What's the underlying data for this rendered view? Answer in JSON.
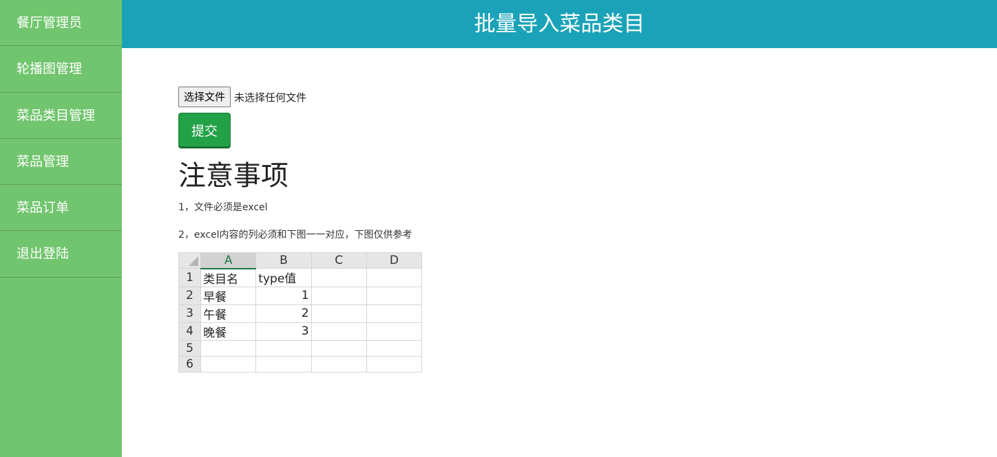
{
  "sidebar": {
    "items": [
      {
        "label": "餐厅管理员"
      },
      {
        "label": "轮播图管理"
      },
      {
        "label": "菜品类目管理"
      },
      {
        "label": "菜品管理"
      },
      {
        "label": "菜品订单"
      },
      {
        "label": "退出登陆"
      }
    ]
  },
  "header": {
    "title": "批量导入菜品类目"
  },
  "upload": {
    "choose_label": "选择文件",
    "status_text": "未选择任何文件",
    "submit_label": "提交"
  },
  "notes": {
    "heading": "注意事项",
    "line1": "1，文件必须是excel",
    "line2": "2，excel内容的列必须和下图一一对应，下图仅供参考"
  },
  "sheet": {
    "columns": [
      "A",
      "B",
      "C",
      "D"
    ],
    "rows": [
      {
        "num": "1",
        "a": "类目名",
        "b": "type值"
      },
      {
        "num": "2",
        "a": "早餐",
        "b": "1"
      },
      {
        "num": "3",
        "a": "午餐",
        "b": "2"
      },
      {
        "num": "4",
        "a": "晚餐",
        "b": "3"
      },
      {
        "num": "5",
        "a": "",
        "b": ""
      },
      {
        "num": "6",
        "a": "",
        "b": ""
      }
    ]
  },
  "colors": {
    "sidebar_bg": "#71c56e",
    "header_bg": "#1aa3b8",
    "submit_bg": "#23a147"
  }
}
